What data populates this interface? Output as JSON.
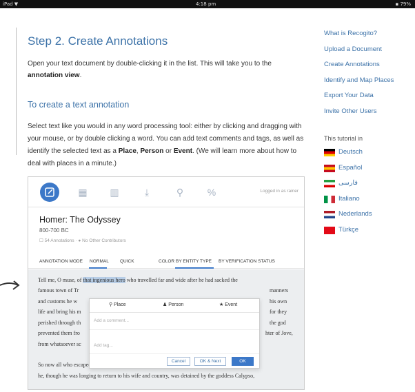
{
  "statusbar": {
    "left": "iPad ▼",
    "time": "4:18 pm",
    "right": "▪ 79%"
  },
  "main": {
    "heading": "Step 2. Create Annotations",
    "intro_pre": "Open your text document by double-clicking it in the list. This will take you to the ",
    "intro_bold": "annotation view",
    "intro_post": ".",
    "subheading": "To create a text annotation",
    "para_pre": "Select text like you would in any word processing tool: either by clicking and dragging with your mouse, or by double clicking a word. You can add text comments and tags, as well as identify the selected text as a ",
    "para_place": "Place",
    "para_comma": ", ",
    "para_person": "Person",
    "para_or": " or ",
    "para_event": "Event",
    "para_post": ". (We will learn more about how to deal with places in a minute.)"
  },
  "rightnav": {
    "links": [
      "What is Recogito?",
      "Upload a Document",
      "Create Annotations",
      "Identify and Map Places",
      "Export Your Data",
      "Invite Other Users"
    ],
    "tutorial_label": "This tutorial in",
    "languages": [
      {
        "name": "Deutsch",
        "colors": [
          "#000000",
          "#dd0000",
          "#ffce00"
        ]
      },
      {
        "name": "Español",
        "colors": [
          "#c60b1e",
          "#ffc400",
          "#c60b1e"
        ]
      },
      {
        "name": "فارسی",
        "colors": [
          "#239f40",
          "#ffffff",
          "#da0000"
        ]
      },
      {
        "name": "Italiano",
        "colors": [
          "#009246",
          "#ffffff",
          "#ce2b37"
        ]
      },
      {
        "name": "Nederlands",
        "colors": [
          "#ae1c28",
          "#ffffff",
          "#21468b"
        ]
      },
      {
        "name": "Türkçe",
        "colors": [
          "#e30a17",
          "#e30a17",
          "#e30a17"
        ]
      }
    ]
  },
  "app": {
    "logged_in": "Logged in as rainer",
    "doc_title": "Homer: The Odyssey",
    "doc_date": "800-700 BC",
    "doc_meta": "☐ 54 Annotations · ● No Other Contributors",
    "mode_label": "ANNOTATION MODE",
    "mode_normal": "NORMAL",
    "mode_quick": "QUICK",
    "color_label": "COLOR",
    "color_by": "BY ENTITY TYPE",
    "color_verif": "BY VERIFICATION STATUS",
    "text1_pre": "Tell me, O muse, of ",
    "text1_hl": "that ingenious hero",
    "text1_post": " who travelled far and wide after he had sacked the",
    "text2": "famous town of Tr",
    "text2_r": "manners",
    "text3": "and customs he w",
    "text3_r": "his own",
    "text4": "life and bring his m",
    "text4_r": "for they",
    "text5": "perished through th",
    "text5_r": "the god",
    "text6": "prevented them fro",
    "text6_r": "hter of Jove,",
    "text7": "from whatsoever sc",
    "text8": "So now all who escaped death in battle or by shipwreck had got safely home except Ulysses, and",
    "text9": "he, though he was longing to return to his wife and country, was detained by the goddess Calypso,",
    "popup": {
      "tab_place": "Place",
      "tab_person": "Person",
      "tab_event": "Event",
      "comment_placeholder": "Add a comment...",
      "tag_placeholder": "Add tag...",
      "cancel": "Cancel",
      "ok_next": "OK & Next",
      "ok": "OK"
    }
  },
  "colors": {
    "accent": "#3c72a8",
    "button": "#3c78c8",
    "highlight": "#b7cde6"
  }
}
